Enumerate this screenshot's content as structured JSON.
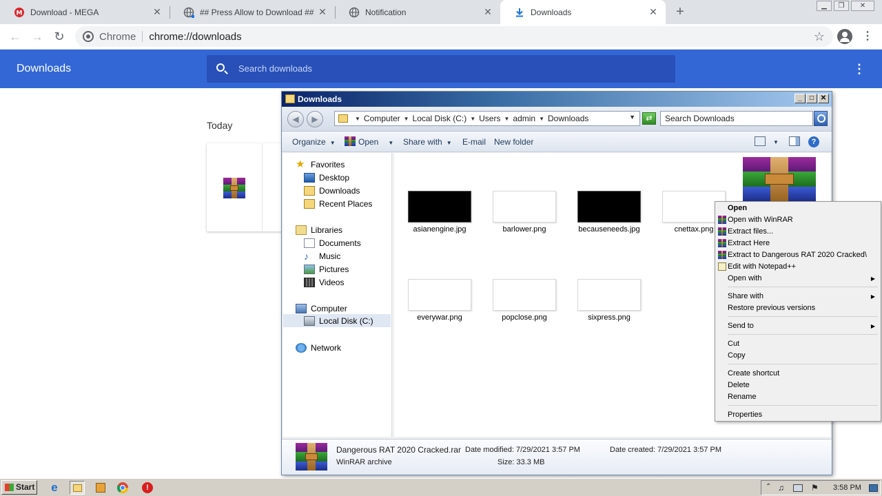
{
  "chrome": {
    "tabs": [
      {
        "title": "Download - MEGA",
        "icon": "mega-icon"
      },
      {
        "title": "## Press Allow to Download ##",
        "icon": "globe-icon"
      },
      {
        "title": "Notification",
        "icon": "globe-icon"
      },
      {
        "title": "Downloads",
        "icon": "download-icon",
        "active": true
      }
    ],
    "new_tab": "+",
    "omnibox": {
      "chip": "Chrome",
      "url": "chrome://downloads"
    }
  },
  "downloads_page": {
    "title": "Downloads",
    "search_placeholder": "Search downloads",
    "section": "Today"
  },
  "explorer": {
    "title": "Downloads",
    "breadcrumb": [
      "Computer",
      "Local Disk (C:)",
      "Users",
      "admin",
      "Downloads"
    ],
    "search_placeholder": "Search Downloads",
    "commands": {
      "organize": "Organize",
      "open": "Open",
      "share_with": "Share with",
      "email": "E-mail",
      "new_folder": "New folder"
    },
    "nav": {
      "favorites": "Favorites",
      "desktop": "Desktop",
      "downloads": "Downloads",
      "recent_places": "Recent Places",
      "libraries": "Libraries",
      "documents": "Documents",
      "music": "Music",
      "pictures": "Pictures",
      "videos": "Videos",
      "computer": "Computer",
      "local_disk": "Local Disk (C:)",
      "network": "Network"
    },
    "files": [
      "asianengine.jpg",
      "barlower.png",
      "becauseneeds.jpg",
      "cnettax.png",
      "everywar.png",
      "popclose.png",
      "sixpress.png"
    ],
    "details": {
      "name": "Dangerous RAT 2020 Cracked.rar",
      "type": "WinRAR archive",
      "date_modified": "Date modified: 7/29/2021 3:57 PM",
      "size": "Size: 33.3 MB",
      "date_created": "Date created: 7/29/2021 3:57 PM"
    }
  },
  "context_menu": {
    "open": "Open",
    "open_with_winrar": "Open with WinRAR",
    "extract_files": "Extract files...",
    "extract_here": "Extract Here",
    "extract_to": "Extract to Dangerous RAT 2020 Cracked\\",
    "edit_notepad": "Edit with Notepad++",
    "open_with": "Open with",
    "share_with": "Share with",
    "restore": "Restore previous versions",
    "send_to": "Send to",
    "cut": "Cut",
    "copy": "Copy",
    "create_shortcut": "Create shortcut",
    "delete": "Delete",
    "rename": "Rename",
    "properties": "Properties"
  },
  "taskbar": {
    "start": "Start",
    "clock": "3:58 PM"
  },
  "colors": {
    "chrome_header": "#3367d6",
    "tab_strip": "#dee1e6",
    "taskbar": "#d4d0c8"
  }
}
